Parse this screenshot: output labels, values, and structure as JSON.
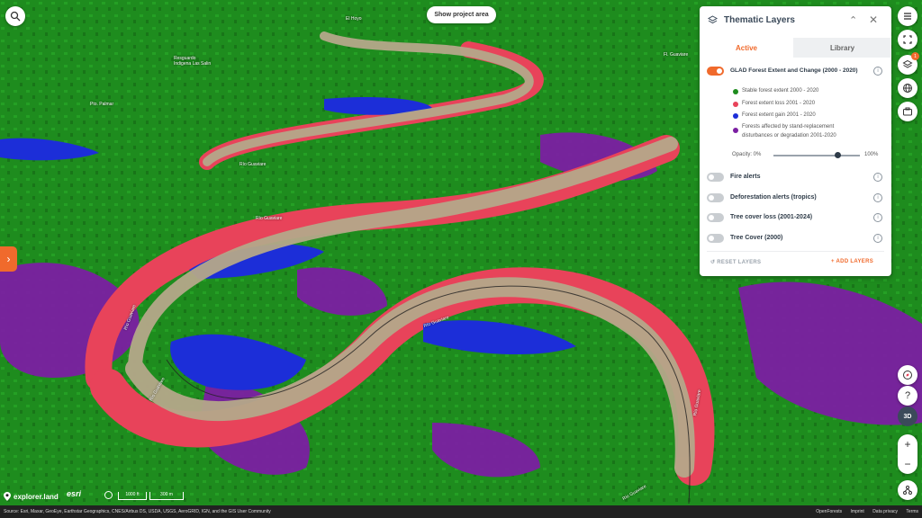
{
  "map": {
    "show_area_label": "Show project area",
    "labels": {
      "el_hoyo": "El Hoyo",
      "resguardo": "Resguardo\nIndigena Las Salin",
      "palmar": "Pto. Palmar",
      "rio1": "Río Guaviare",
      "rio2": "Río Guaviare",
      "rio3": "Río Guaviare",
      "rio4": "Río Guaviare",
      "rio5": "Río Guaviare",
      "rio6": "Río Guaviare",
      "rio7": "Río Guaviare",
      "fiscal": "Fl. Guaviare"
    },
    "colors": {
      "forest": "#1e8c1e",
      "loss": "#e8435a",
      "gain": "#1c2ed8",
      "degradation": "#7b1fa2",
      "river": "#b5a88a"
    }
  },
  "panel": {
    "title": "Thematic Layers",
    "tabs": {
      "active": "Active",
      "library": "Library"
    },
    "main_layer": {
      "name": "GLAD Forest Extent and Change (2000 - 2020)",
      "legend": [
        {
          "color": "#1e8c1e",
          "text": "Stable forest extent 2000 - 2020"
        },
        {
          "color": "#e8435a",
          "text": "Forest extent loss 2001 - 2020"
        },
        {
          "color": "#1c2ed8",
          "text": "Forest extent gain 2001 - 2020"
        },
        {
          "color": "#7b1fa2",
          "text": "Forests affected by stand-replacement"
        },
        {
          "color": "",
          "text": "disturbances or degradation 2001-2020"
        }
      ],
      "opacity_label": "Opacity:  0%",
      "opacity_max": "100%",
      "opacity_value": 0.8
    },
    "layers": [
      {
        "name": "Fire alerts"
      },
      {
        "name": "Deforestation alerts (tropics)"
      },
      {
        "name": "Tree cover loss (2001-2024)"
      },
      {
        "name": "Tree Cover (2000)"
      }
    ],
    "reset_label": "RESET LAYERS",
    "add_label": "+ ADD LAYERS"
  },
  "right_bar": {
    "badge": "1",
    "btn_3d": "3D",
    "help": "?"
  },
  "brand": {
    "name": "explorer.land",
    "esri": "esri"
  },
  "scale": {
    "ft": "1000 ft",
    "m": "300 m"
  },
  "footer": {
    "attribution": "Source: Esri, Maxar, GeoEye, Earthstar Geographics, CNES/Airbus DS, USDA, USGS, AeroGRID, IGN, and the GIS User Community",
    "links": [
      "OpenForests",
      "Imprint",
      "Data privacy",
      "Terms"
    ]
  }
}
